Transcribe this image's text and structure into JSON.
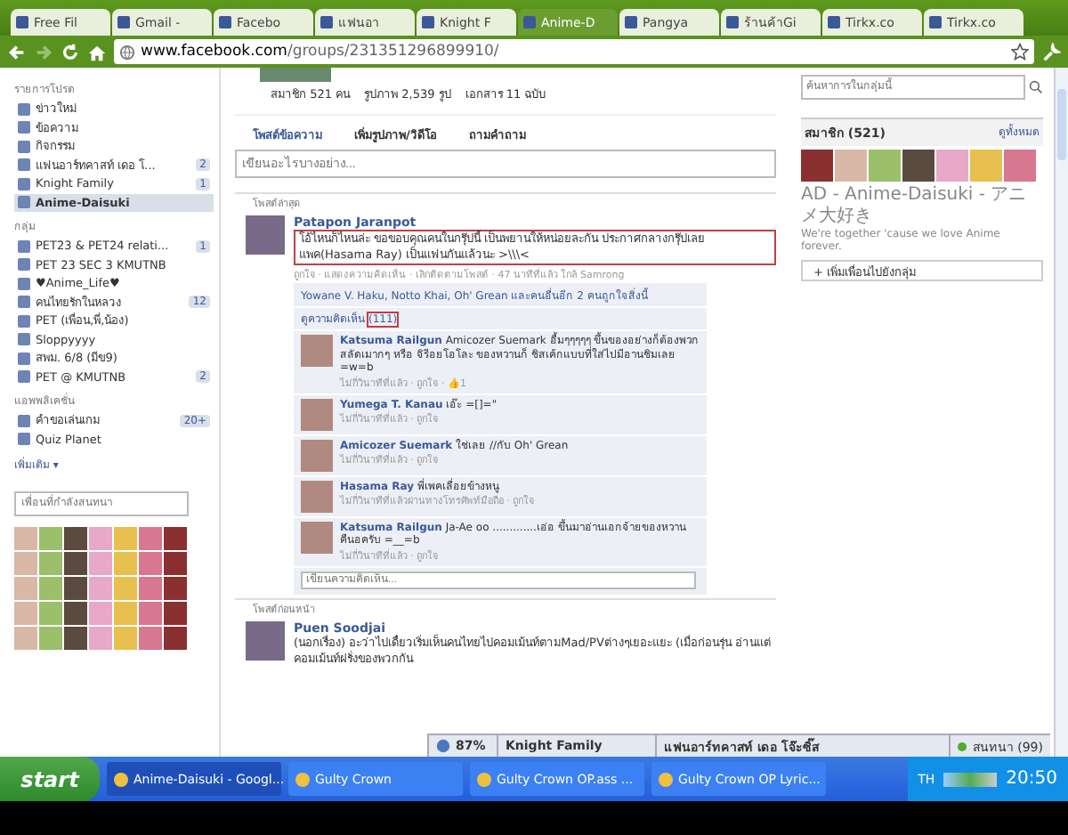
{
  "browser": {
    "tabs": [
      {
        "label": "Free Fil",
        "selected": false
      },
      {
        "label": "Gmail - ",
        "selected": false
      },
      {
        "label": "Facebo",
        "selected": false
      },
      {
        "label": "แฟนอา",
        "selected": false
      },
      {
        "label": "Knight F",
        "selected": false
      },
      {
        "label": "Anime-D",
        "selected": true
      },
      {
        "label": "Pangya",
        "selected": false
      },
      {
        "label": "ร้านค้าGi",
        "selected": false
      },
      {
        "label": "Tirkx.co",
        "selected": false
      },
      {
        "label": "Tirkx.co",
        "selected": false
      }
    ],
    "url_host": "www.facebook.com",
    "url_path": "/groups/231351296899910/"
  },
  "sidebar": {
    "sections": [
      {
        "title": "รายการโปรด",
        "items": [
          {
            "label": "ข่าวใหม่",
            "selected": false
          },
          {
            "label": "ข้อความ",
            "selected": false
          },
          {
            "label": "กิจกรรม",
            "selected": false
          },
          {
            "label": "แฟนอาร์ทคาสท์ เดอ โ...",
            "count": "2",
            "selected": false
          },
          {
            "label": "Knight Family",
            "count": "1",
            "selected": false
          },
          {
            "label": "Anime-Daisuki",
            "selected": true
          }
        ]
      },
      {
        "title": "กลุ่ม",
        "items": [
          {
            "label": "PET23 & PET24 relati...",
            "count": "1",
            "selected": false
          },
          {
            "label": "PET 23 SEC 3 KMUTNB",
            "selected": false
          },
          {
            "label": "♥Anime_Life♥",
            "selected": false
          },
          {
            "label": "คนไทยรักในหลวง",
            "count": "12",
            "selected": false
          },
          {
            "label": "PET (เพื่อน,พี่,น้อง)",
            "selected": false
          },
          {
            "label": "Sloppyyyy",
            "selected": false
          },
          {
            "label": "สพม. 6/8 (มีข9)",
            "selected": false
          },
          {
            "label": "PET @ KMUTNB",
            "count": "2",
            "selected": false
          }
        ]
      },
      {
        "title": "แอพพลิเคชั่น",
        "items": [
          {
            "label": "คำขอเล่นเกม",
            "count": "20+",
            "selected": false
          },
          {
            "label": "Quiz Planet",
            "selected": false
          }
        ]
      }
    ],
    "more": "เพิ่มเติม ▾",
    "chat_search": {
      "placeholder": "เพื่อนที่กำลังสนทนา"
    }
  },
  "group": {
    "stats": [
      "สมาชิก 521 คน",
      "รูปภาพ 2,539 รูป",
      "เอกสาร 11 ฉบับ"
    ],
    "composer_tabs": [
      {
        "label": "โพสต์ข้อความ",
        "selected": true
      },
      {
        "label": "เพิ่มรูปภาพ/วิดีโอ",
        "selected": false
      },
      {
        "label": "ถามคำถาม",
        "selected": false
      }
    ],
    "composer": {
      "placeholder": "เขียนอะไรบางอย่าง..."
    },
    "recent_heading": "โพสต์ล่าสุด",
    "post": {
      "author": "Patapon Jaranpot",
      "text": "โอ้ไหนก็ไหนล่ะ ขอขอบคุณคนในกรุ๊ปนี้ เป็นพยานให้หน่อยละกัน ประกาศกลางกรุ๊ปเลย แพค(Hasama Ray) เป็นแฟนกันแล้วนะ >\\\\\\<",
      "meta": "ถูกใจ · แสดงความคิดเห็น · เลิกติดตามโพสต์ · 47 นาทีที่แล้ว ใกล้ Samrong",
      "likes": "Yowane V. Haku, Notto Khai, Oh' Grean และคนอื่นอีก 2 คนถูกใจสิ่งนี้",
      "view_comments": "ดูความคิดเห็น",
      "comment_count": "(111)",
      "comments": [
        {
          "author": "Katsuma Railgun",
          "text": "Amicozer Suemark อื้มๆๆๆๆๆ ขึ้นของอย่างก็ต้องพวกสลัดเมากๆ หรือ จิรีอยโอโละ ของหวานก็ ชิสเค้กแบบที่ใส่ไปมีอานชิมเลย =w=b",
          "meta": "ไม่กี่วินาทีที่แล้ว · ถูกใจ · 👍1"
        },
        {
          "author": "Yumega T. Kanau",
          "text": "เอ๊ะ =[]=\"",
          "meta": "ไม่กี่วินาทีที่แล้ว · ถูกใจ"
        },
        {
          "author": "Amicozer Suemark",
          "text": "ใช่เลย //กับ Oh' Grean",
          "meta": "ไม่กี่วินาทีที่แล้ว · ถูกใจ"
        },
        {
          "author": "Hasama Ray",
          "text": "พี่เพคเลื่อยข้างหนู",
          "meta": "ไม่กี่วินาทีที่แล้วผ่านทางโทรศัพท์มือถือ · ถูกใจ"
        },
        {
          "author": "Katsuma Railgun",
          "text": "Ja-Ae oo .............เอ่อ ขึ้นมาอ่านเอกจ้ายของหวานคืนอครับ =__=b",
          "meta": "ไม่กี่วินาทีที่แล้ว · ถูกใจ"
        }
      ],
      "comment_input": {
        "placeholder": "เขียนความคิดเห็น..."
      }
    },
    "older_heading": "โพสต์ก่อนหน้า",
    "older_post": {
      "author": "Puen Soodjai",
      "text": "(นอกเรื่อง) อะว่าไปเดี๋ยวเริ่มเห็นคนไทยไปคอมเม้นท์ตามMad/PVต่างๆเยอะแยะ (เมื่อก่อนรุ่น อ่านแต่คอมเม้นท์ฝรั่งของพวกกัน"
    }
  },
  "right": {
    "search": {
      "placeholder": "ค้นหาการในกลุ่มนี้"
    },
    "members_title": "สมาชิก (521)",
    "see_all": "ดูทั้งหมด",
    "description_title": "AD - Anime-Daisuki - アニメ大好き",
    "description": "We're together 'cause we love Anime forever.",
    "add_button": "+ เพิ่มเพื่อนไปยังกลุ่ม"
  },
  "chat_bar": {
    "items": [
      {
        "kind": "status",
        "label": "87%"
      },
      {
        "kind": "chat",
        "label": "Knight Family"
      },
      {
        "kind": "chat",
        "label": "แฟนอาร์ทคาสท์ เดอ โจ๊ะซิ๊ส"
      },
      {
        "kind": "online",
        "label": "สนทนา (99)"
      }
    ]
  },
  "taskbar": {
    "start": "start",
    "items": [
      {
        "label": "Anime-Daisuki - Googl...",
        "selected": true
      },
      {
        "label": "Gulty Crown",
        "selected": false
      },
      {
        "label": "Gulty Crown OP.ass ...",
        "selected": false
      },
      {
        "label": "Gulty Crown OP Lyric...",
        "selected": false
      }
    ],
    "language": "TH",
    "clock": "20:50"
  }
}
